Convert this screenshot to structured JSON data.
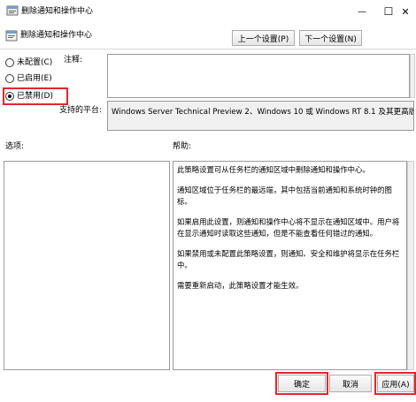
{
  "window": {
    "title": "删除通知和操作中心",
    "minimize_glyph": "—",
    "maximize_glyph": "☐",
    "close_glyph": "✕"
  },
  "header": {
    "policy_name": "删除通知和操作中心",
    "prev_label": "上一个设置(P)",
    "next_label": "下一个设置(N)"
  },
  "state": {
    "options": [
      {
        "label": "未配置(C)",
        "selected": false
      },
      {
        "label": "已启用(E)",
        "selected": false
      },
      {
        "label": "已禁用(D)",
        "selected": true
      }
    ]
  },
  "comment": {
    "label": "注释:",
    "value": ""
  },
  "platform": {
    "label": "支持的平台:",
    "value": "Windows Server Technical Preview 2、Windows 10 或 Windows RT 8.1 及其更高版本"
  },
  "sections": {
    "options_label": "选项:",
    "help_label": "帮助:"
  },
  "help": {
    "paragraphs": [
      "此策略设置可从任务栏的通知区域中删除通知和操作中心。",
      "通知区域位于任务栏的最远端，其中包括当前通知和系统时钟的图标。",
      "如果启用此设置，则通知和操作中心将不显示在通知区域中。用户将在显示通知时读取这些通知，但是不能查看任何错过的通知。",
      "如果禁用或未配置此策略设置，则通知、安全和维护将显示在任务栏中。",
      "需要重新启动，此策略设置才能生效。"
    ]
  },
  "footer": {
    "ok_label": "确定",
    "cancel_label": "取消",
    "apply_label": "应用(A)"
  },
  "colors": {
    "highlight": "#e3262f"
  }
}
